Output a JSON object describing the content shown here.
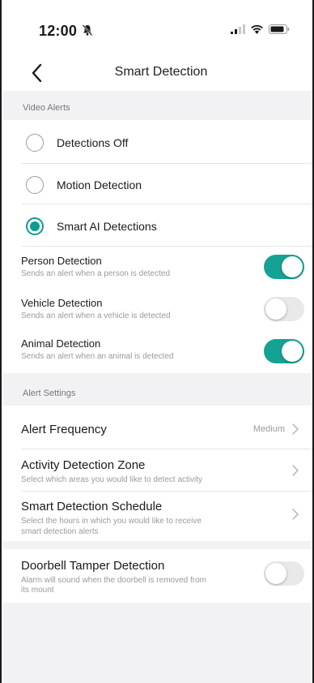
{
  "status_bar": {
    "time": "12:00"
  },
  "nav": {
    "title": "Smart Detection"
  },
  "video_alerts": {
    "section_title": "Video Alerts",
    "options": [
      {
        "label": "Detections Off",
        "selected": false
      },
      {
        "label": "Motion Detection",
        "selected": false
      },
      {
        "label": "Smart AI Detections",
        "selected": true
      }
    ],
    "detections": [
      {
        "title": "Person Detection",
        "subtitle": "Sends an alert when a person is detected",
        "enabled": true
      },
      {
        "title": "Vehicle Detection",
        "subtitle": "Sends an alert when a vehicle is detected",
        "enabled": false
      },
      {
        "title": "Animal Detection",
        "subtitle": "Sends an alert when an animal is detected",
        "enabled": true
      }
    ]
  },
  "alert_settings": {
    "section_title": "Alert Settings",
    "frequency": {
      "title": "Alert Frequency",
      "value": "Medium"
    },
    "zone": {
      "title": "Activity Detection Zone",
      "subtitle": "Select which areas you would like to detect activity"
    },
    "schedule": {
      "title": "Smart Detection Schedule",
      "subtitle_line1": "Select the hours in which you would like to receive",
      "subtitle_line2": "smart detection alerts"
    }
  },
  "tamper": {
    "title": "Doorbell Tamper Detection",
    "subtitle_line1": "Alarm will sound when the doorbell is removed from",
    "subtitle_line2": "its mount",
    "enabled": false
  },
  "colors": {
    "accent": "#14a294",
    "section_bg": "#f2f2f4",
    "muted_text": "#9a9a9a"
  },
  "icons": [
    "bell-off-icon",
    "signal-icon",
    "wifi-icon",
    "battery-icon",
    "back-chevron-icon",
    "chevron-right-icon"
  ]
}
